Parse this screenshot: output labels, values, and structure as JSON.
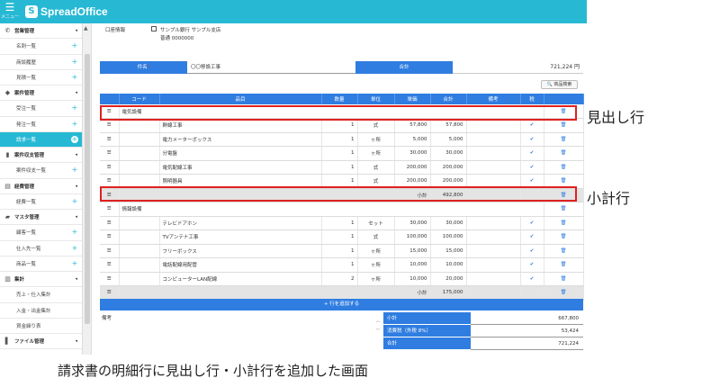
{
  "app": {
    "menu_label": "メニュー",
    "logo_text": "SpreadOffice"
  },
  "sidebar": {
    "items": [
      {
        "type": "cat",
        "icon": "phone-icon",
        "glyph": "✆",
        "label": "営業管理",
        "suffix": "◂"
      },
      {
        "type": "sub",
        "label": "名刺一覧",
        "suffix": "+"
      },
      {
        "type": "sub",
        "label": "商談履歴",
        "suffix": "+"
      },
      {
        "type": "sub",
        "label": "見積一覧",
        "suffix": "+"
      },
      {
        "type": "cat",
        "icon": "tag-icon",
        "glyph": "◆",
        "label": "案件管理",
        "suffix": "◂"
      },
      {
        "type": "sub",
        "label": "受注一覧",
        "suffix": "+"
      },
      {
        "type": "sub",
        "label": "発注一覧",
        "suffix": "+"
      },
      {
        "type": "sub",
        "label": "請求一覧",
        "suffix": "+",
        "active": true
      },
      {
        "type": "cat",
        "icon": "bar-chart-icon",
        "glyph": "▮",
        "label": "案件収支管理",
        "suffix": "◂"
      },
      {
        "type": "sub",
        "label": "案件収支一覧",
        "suffix": "+"
      },
      {
        "type": "cat",
        "icon": "ledger-icon",
        "glyph": "▤",
        "label": "経費管理",
        "suffix": "◂"
      },
      {
        "type": "sub",
        "label": "経費一覧",
        "suffix": "+"
      },
      {
        "type": "cat",
        "icon": "folder-icon",
        "glyph": "▰",
        "label": "マスタ管理",
        "suffix": "◂"
      },
      {
        "type": "sub",
        "label": "顧客一覧",
        "suffix": "+"
      },
      {
        "type": "sub",
        "label": "仕入先一覧",
        "suffix": "+"
      },
      {
        "type": "sub",
        "label": "商品一覧",
        "suffix": "+"
      },
      {
        "type": "cat",
        "icon": "stats-icon",
        "glyph": "▥",
        "label": "集計",
        "suffix": "◂"
      },
      {
        "type": "sub",
        "label": "売上・仕入集計",
        "suffix": ""
      },
      {
        "type": "sub",
        "label": "入金・出金集計",
        "suffix": ""
      },
      {
        "type": "sub",
        "label": "資金繰り表",
        "suffix": ""
      },
      {
        "type": "cat",
        "icon": "file-icon",
        "glyph": "▌",
        "label": "ファイル管理",
        "suffix": "◂"
      }
    ]
  },
  "bank": {
    "label": "口座情報",
    "name": "サンプル銀行 サンプル支店",
    "account": "普通 0000000"
  },
  "subject": {
    "label": "件名",
    "required_mark": "*",
    "value": "〇〇移設工事",
    "total_label": "合計",
    "total_value": "721,224 円"
  },
  "product_search_label": "🔍 商品検索",
  "table": {
    "headers": [
      "",
      "コード",
      "品目",
      "数量",
      "単位",
      "単価",
      "合計",
      "備考",
      "税",
      ""
    ],
    "rows": [
      {
        "kind": "heading",
        "item": "電気設備"
      },
      {
        "kind": "line",
        "item": "幹線工事",
        "qty": "1",
        "unit": "式",
        "price": "57,800",
        "total": "57,800",
        "tax": true
      },
      {
        "kind": "line",
        "item": "電力メーターボックス",
        "qty": "1",
        "unit": "ヶ所",
        "price": "5,000",
        "total": "5,000",
        "tax": true
      },
      {
        "kind": "line",
        "item": "分電盤",
        "qty": "1",
        "unit": "ヶ所",
        "price": "30,000",
        "total": "30,000",
        "tax": true
      },
      {
        "kind": "line",
        "item": "電気配線工事",
        "qty": "1",
        "unit": "式",
        "price": "200,000",
        "total": "200,000",
        "tax": true
      },
      {
        "kind": "line",
        "item": "照明器具",
        "qty": "1",
        "unit": "式",
        "price": "200,000",
        "total": "200,000",
        "tax": true
      },
      {
        "kind": "subtotal",
        "label": "小計",
        "total": "492,800"
      },
      {
        "kind": "heading",
        "item": "情報設備"
      },
      {
        "kind": "line",
        "item": "テレビドアホン",
        "qty": "1",
        "unit": "セット",
        "price": "30,000",
        "total": "30,000",
        "tax": true
      },
      {
        "kind": "line",
        "item": "TVアンテナ工事",
        "qty": "1",
        "unit": "式",
        "price": "100,000",
        "total": "100,000",
        "tax": true
      },
      {
        "kind": "line",
        "item": "フリーボックス",
        "qty": "1",
        "unit": "ヶ所",
        "price": "15,000",
        "total": "15,000",
        "tax": true
      },
      {
        "kind": "line",
        "item": "電話配線用配管",
        "qty": "1",
        "unit": "ヶ所",
        "price": "10,000",
        "total": "10,000",
        "tax": true
      },
      {
        "kind": "line",
        "item": "コンピューターLAN配線",
        "qty": "2",
        "unit": "ヶ所",
        "price": "10,000",
        "total": "20,000",
        "tax": true
      },
      {
        "kind": "subtotal",
        "label": "小計",
        "total": "175,000"
      }
    ]
  },
  "add_row_label": "+ 行を追加する",
  "remarks_label": "備考",
  "summary": [
    {
      "label": "小計",
      "value": "667,800"
    },
    {
      "label": "消費税（外税 8%）",
      "value": "53,424"
    },
    {
      "label": "合計",
      "value": "721,224"
    }
  ],
  "annotations": {
    "heading_callout": "見出し行",
    "subtotal_callout": "小計行",
    "caption": "請求書の明細行に見出し行・小計行を追加した画面"
  },
  "colors": {
    "topbar": "#27b9d4",
    "table_header": "#2f7de1",
    "highlight": "#e02020"
  }
}
